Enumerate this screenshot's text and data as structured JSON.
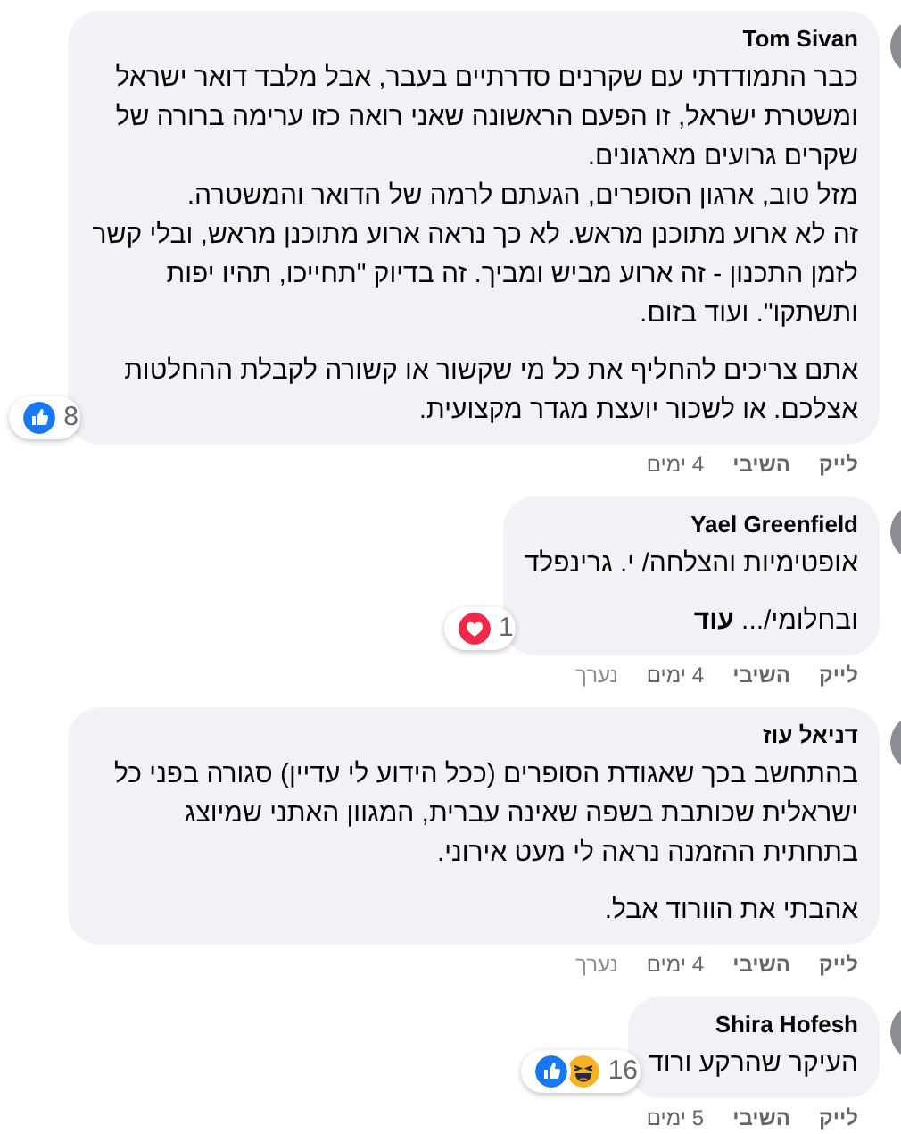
{
  "comments": [
    {
      "author": "Tom Sivan",
      "paragraphs": [
        [
          "כבר התמודדתי עם שקרנים סדרתיים בעבר, אבל מלבד דואר ישראל ומשטרת ישראל, זו הפעם הראשונה שאני רואה כזו ערימה ברורה של שקרים גרועים מארגונים.",
          "מזל טוב, ארגון הסופרים, הגעתם לרמה של הדואר והמשטרה.",
          "זה לא ארוע מתוכנן מראש. לא כך נראה ארוע מתוכנן מראש, ובלי קשר לזמן התכנון - זה ארוע מביש ומביך. זה בדיוק \"תחייכו, תהיו יפות ותשתקו\". ועוד בזום."
        ],
        [
          "אתם צריכים להחליף את כל מי שקשור או קשורה לקבלת ההחלטות אצלכם. או לשכור יועצת מגדר מקצועית."
        ]
      ],
      "reactions": {
        "icons": [
          {
            "kind": "like"
          }
        ],
        "count": "8"
      },
      "actions": {
        "like": "לייק",
        "reply": "השיבי",
        "time": "4 ימים"
      }
    },
    {
      "author": "Yael Greenfield",
      "paragraphs": [
        [
          "אופטימיות והצלחה/ י. גרינפלד"
        ],
        [
          "ובחלומי/... **עוד**"
        ]
      ],
      "reactions": {
        "icons": [
          {
            "kind": "love"
          }
        ],
        "count": "1"
      },
      "actions": {
        "like": "לייק",
        "reply": "השיבי",
        "time": "4 ימים",
        "edited": "נערך"
      }
    },
    {
      "author": "דניאל עוז",
      "paragraphs": [
        [
          "בהתחשב בכך שאגודת הסופרים (ככל הידוע לי עדיין) סגורה בפני כל ישראלית שכותבת בשפה שאינה עברית, המגוון האתני שמיוצג בתחתית ההזמנה נראה לי מעט אירוני."
        ],
        [
          "אהבתי את הוורוד אבל."
        ]
      ],
      "actions": {
        "like": "לייק",
        "reply": "השיבי",
        "time": "4 ימים",
        "edited": "נערך"
      }
    },
    {
      "author": "Shira Hofesh",
      "paragraphs": [
        [
          "העיקר שהרקע ורוד"
        ]
      ],
      "reactions": {
        "icons": [
          {
            "kind": "like"
          },
          {
            "kind": "haha"
          }
        ],
        "count": "16"
      },
      "actions": {
        "like": "לייק",
        "reply": "השיבי",
        "time": "5 ימים"
      }
    }
  ]
}
